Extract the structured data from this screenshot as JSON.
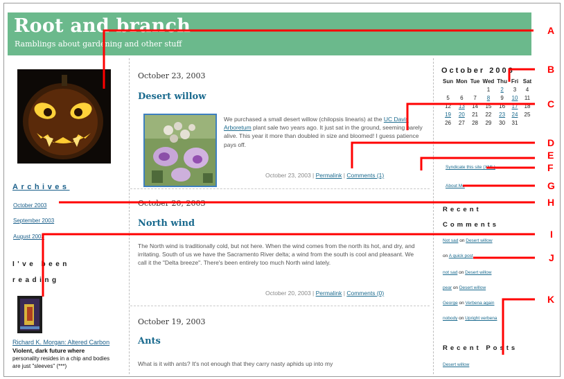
{
  "header": {
    "title": "Root and branch",
    "tagline": "Ramblings about gardening and other stuff"
  },
  "left": {
    "archives_heading": "Archives",
    "archive_links": [
      "October 2003",
      "September 2003",
      "August 2003"
    ],
    "reading_heading_line1": "I've been",
    "reading_heading_line2": "reading",
    "book_link": "Richard K. Morgan: Altered Carbon",
    "book_note_bold": "Violent, dark future where",
    "book_note_rest": "personality resides in a chip and bodies are just \"sleeves\" (***)"
  },
  "posts": [
    {
      "date": "October 23, 2003",
      "title": "Desert willow",
      "body_before": "We purchased a small desert willow (chilopsis linearis) at the ",
      "body_link": "UC Davis Arboretum",
      "body_after": " plant sale two years ago. It just sat in the ground, seeming barely alive. This year it more than doubled in size and bloomed! I guess patience pays off.",
      "footer_date": "October 23, 2003",
      "permalink": "Permalink",
      "comments": "Comments (1)"
    },
    {
      "date": "October 20, 2003",
      "title": "North wind",
      "body": "The North wind is traditionally cold, but not here. When the wind comes from the north its hot, and dry, and irritating. South of us we have the Sacramento River delta; a wind from the south is cool and pleasant. We call it the \"Delta breeze\". There's been entirely too much North wind lately.",
      "footer_date": "October 20, 2003",
      "permalink": "Permalink",
      "comments": "Comments (0)"
    },
    {
      "date": "October 19, 2003",
      "title": "Ants",
      "body": "What is it with ants? It's not enough that they carry nasty aphids up into my"
    }
  ],
  "calendar": {
    "title": "October 2003",
    "weekdays": [
      "Sun",
      "Mon",
      "Tue",
      "Wed",
      "Thu",
      "Fri",
      "Sat"
    ],
    "weeks": [
      [
        "",
        "",
        "",
        "1",
        "2",
        "3",
        "4"
      ],
      [
        "5",
        "6",
        "7",
        "8",
        "9",
        "10",
        "11"
      ],
      [
        "12",
        "13",
        "14",
        "15",
        "16",
        "17",
        "18"
      ],
      [
        "19",
        "20",
        "21",
        "22",
        "23",
        "24",
        "25"
      ],
      [
        "26",
        "27",
        "28",
        "29",
        "30",
        "31",
        ""
      ]
    ],
    "linked_days": [
      "2",
      "8",
      "10",
      "13",
      "17",
      "19",
      "20",
      "23",
      "24"
    ]
  },
  "right": {
    "syndicate": "Syndicate this site (XML)",
    "about": "About Me",
    "recent_comments_heading_1": "Recent",
    "recent_comments_heading_2": "Comments",
    "recent_comments": [
      {
        "author": "Not sad",
        "sep": " on ",
        "post": "Desert willow"
      },
      {
        "author": "",
        "sep": "on ",
        "post": "A quick post"
      },
      {
        "author": "not sad",
        "sep": " on ",
        "post": "Desert willow"
      },
      {
        "author": "pear",
        "sep": " on ",
        "post": "Desert willow"
      },
      {
        "author": "George",
        "sep": " on ",
        "post": "Verbena again"
      },
      {
        "author": "nobody",
        "sep": " on ",
        "post": "Upright verbena"
      }
    ],
    "recent_posts_heading": "Recent Posts",
    "recent_posts": [
      "Desert willow"
    ]
  },
  "callouts": [
    "A",
    "B",
    "C",
    "D",
    "E",
    "F",
    "G",
    "H",
    "I",
    "J",
    "K"
  ],
  "colors": {
    "header_bg": "#6bb98c",
    "link": "#1a6a8e",
    "callout": "#ff0000"
  }
}
